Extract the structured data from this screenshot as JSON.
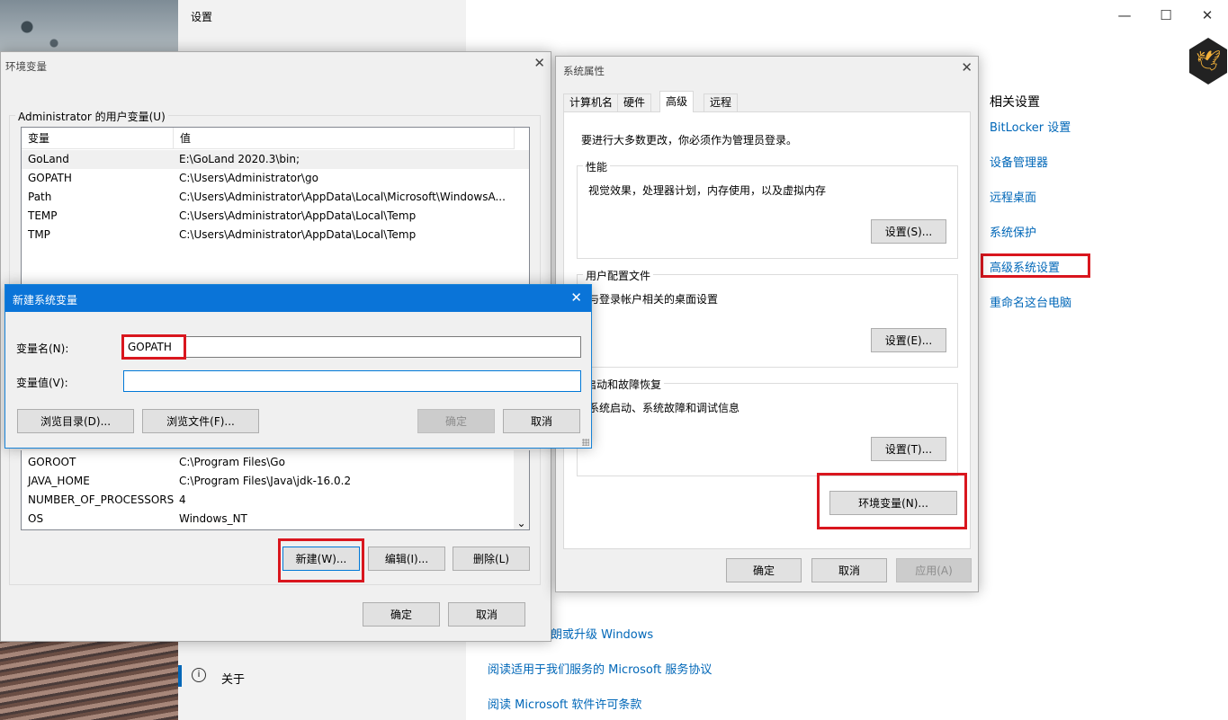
{
  "settings": {
    "title": "设置",
    "related_heading": "相关设置",
    "related_links": [
      "BitLocker 设置",
      "设备管理器",
      "远程桌面",
      "系统保护",
      "高级系统设置",
      "重命名这台电脑"
    ],
    "bottom_links": [
      "朗或升级 Windows",
      "阅读适用于我们服务的 Microsoft 服务协议",
      "阅读 Microsoft 软件许可条款"
    ],
    "about_label": "关于",
    "window_controls": {
      "minimize": "—",
      "maximize": "☐",
      "close": "✕"
    }
  },
  "env_dialog": {
    "title": "环境变量",
    "close": "✕",
    "user_group_label": "Administrator 的用户变量(U)",
    "columns": [
      "变量",
      "值"
    ],
    "user_vars": [
      {
        "name": "GoLand",
        "value": "E:\\GoLand 2020.3\\bin;"
      },
      {
        "name": "GOPATH",
        "value": "C:\\Users\\Administrator\\go"
      },
      {
        "name": "Path",
        "value": "C:\\Users\\Administrator\\AppData\\Local\\Microsoft\\WindowsA..."
      },
      {
        "name": "TEMP",
        "value": "C:\\Users\\Administrator\\AppData\\Local\\Temp"
      },
      {
        "name": "TMP",
        "value": "C:\\Users\\Administrator\\AppData\\Local\\Temp"
      }
    ],
    "system_vars": [
      {
        "name": "GOROOT",
        "value": "C:\\Program Files\\Go"
      },
      {
        "name": "JAVA_HOME",
        "value": "C:\\Program Files\\Java\\jdk-16.0.2"
      },
      {
        "name": "NUMBER_OF_PROCESSORS",
        "value": "4"
      },
      {
        "name": "OS",
        "value": "Windows_NT"
      }
    ],
    "scroll_down": "⌄",
    "buttons": {
      "new": "新建(W)...",
      "edit": "编辑(I)...",
      "delete": "删除(L)",
      "ok": "确定",
      "cancel": "取消"
    }
  },
  "sys_dialog": {
    "title": "系统属性",
    "close": "✕",
    "tabs": [
      "计算机名",
      "硬件",
      "高级",
      "远程"
    ],
    "admin_note": "要进行大多数更改，你必须作为管理员登录。",
    "performance": {
      "label": "性能",
      "desc": "视觉效果，处理器计划，内存使用，以及虚拟内存",
      "button": "设置(S)..."
    },
    "profile": {
      "label": "用户配置文件",
      "desc": "与登录帐户相关的桌面设置",
      "button": "设置(E)..."
    },
    "startup": {
      "label": "启动和故障恢复",
      "desc": "系统启动、系统故障和调试信息",
      "button": "设置(T)..."
    },
    "env_button": "环境变量(N)...",
    "ok": "确定",
    "cancel": "取消",
    "apply": "应用(A)"
  },
  "new_dialog": {
    "title": "新建系统变量",
    "close": "✕",
    "name_label": "变量名(N):",
    "name_value": "GOPATH",
    "value_label": "变量值(V):",
    "value_value": "",
    "browse_dir": "浏览目录(D)...",
    "browse_file": "浏览文件(F)...",
    "ok": "确定",
    "cancel": "取消"
  },
  "colors": {
    "link": "#0067b8",
    "highlight_box": "#d9161e",
    "title_bar": "#0a74d8"
  }
}
